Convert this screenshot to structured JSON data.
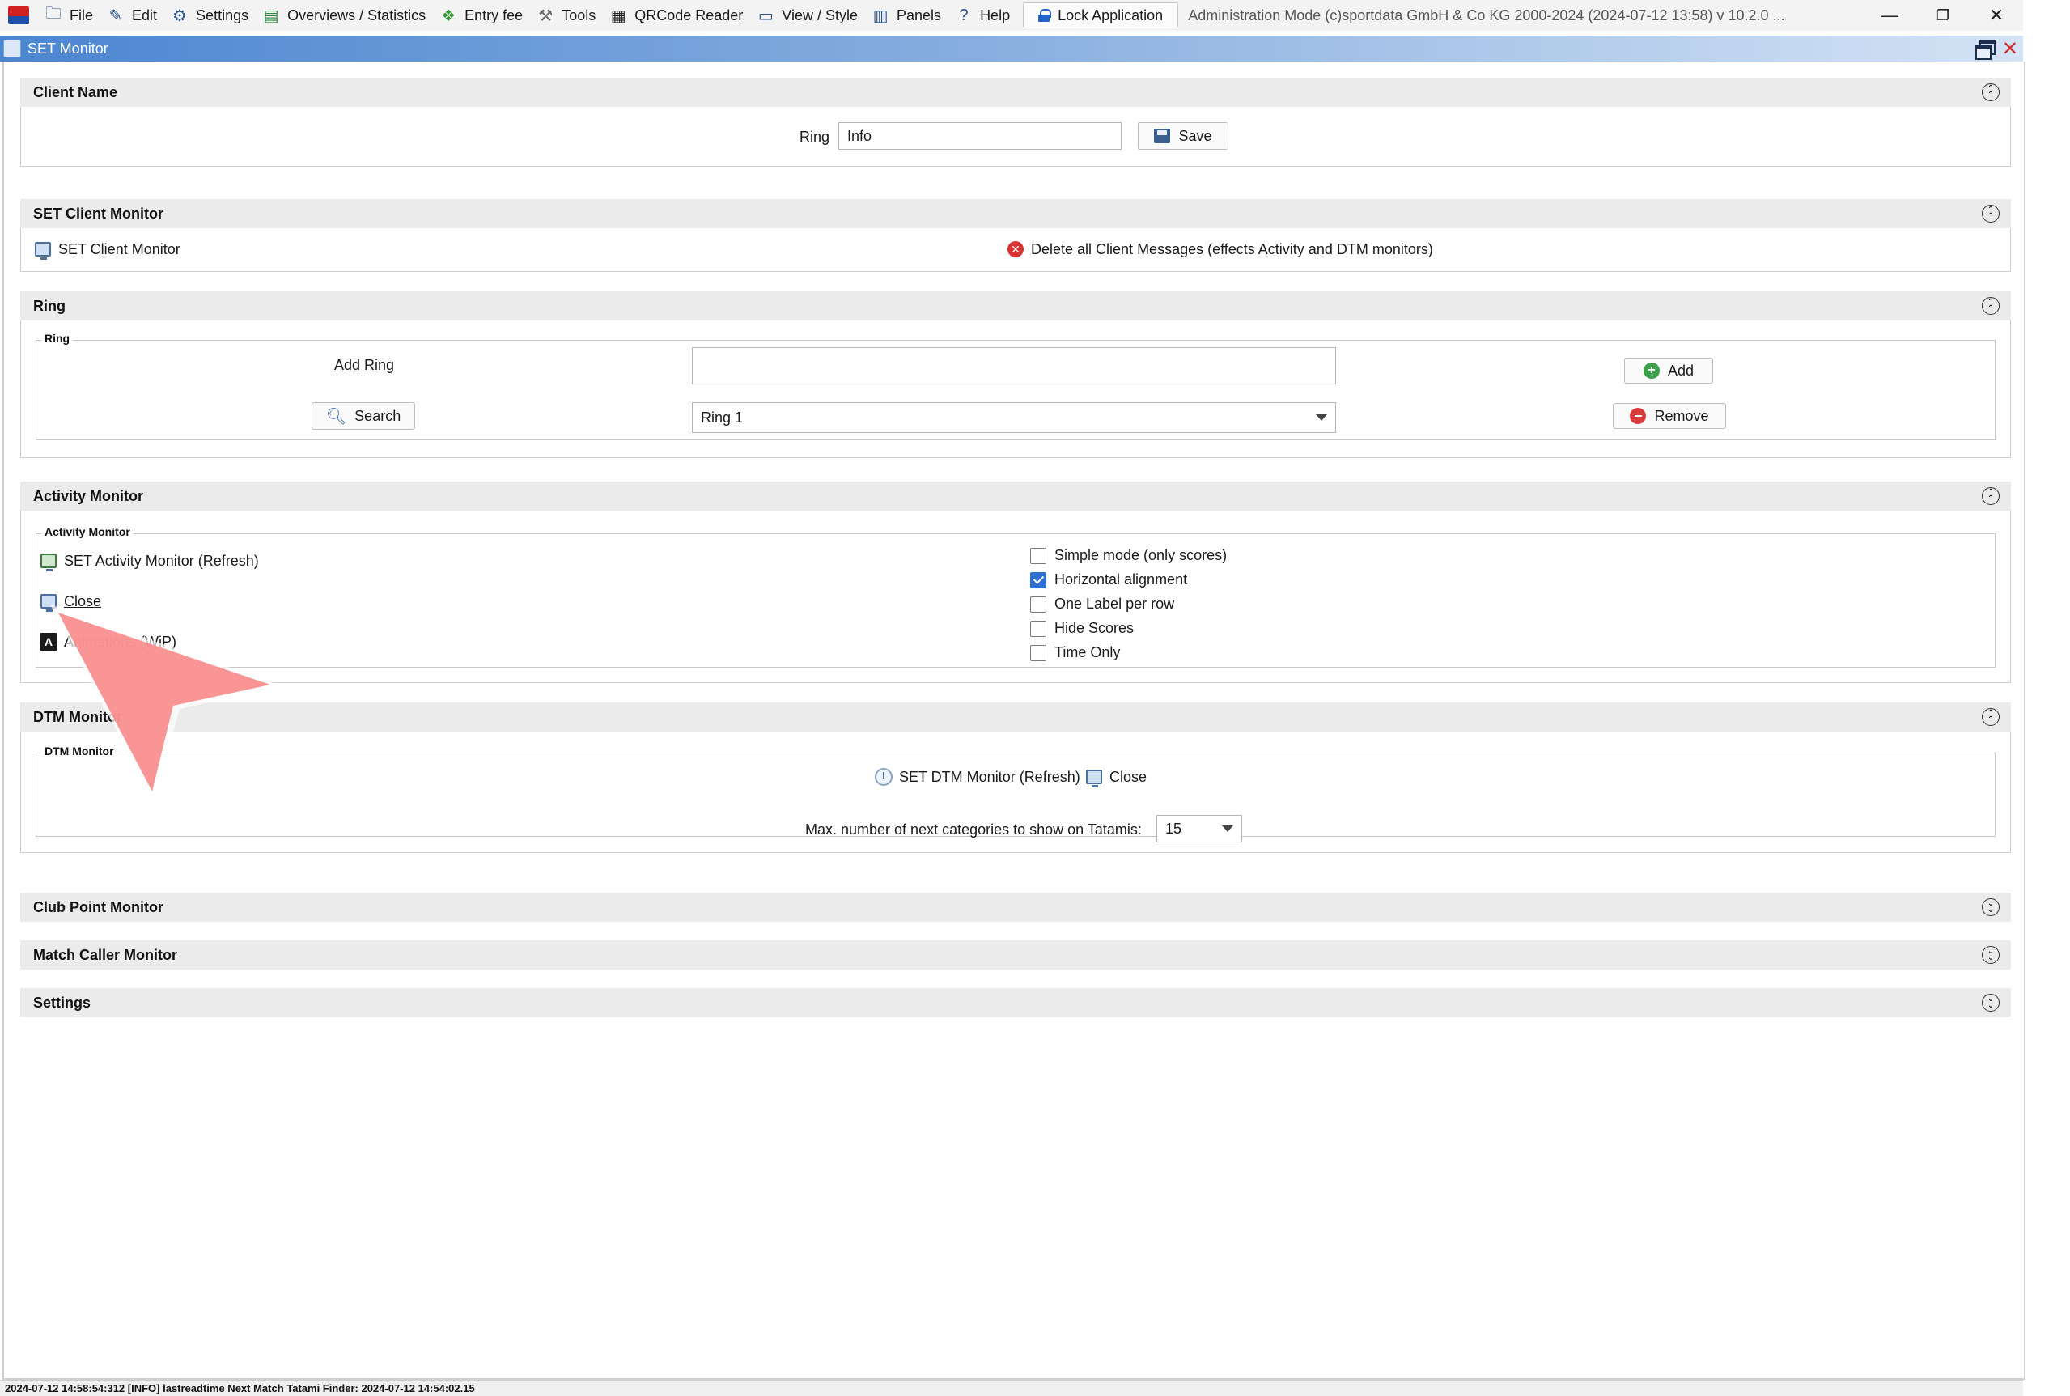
{
  "menubar": {
    "items": [
      {
        "label": "File",
        "icon": "file-icon"
      },
      {
        "label": "Edit",
        "icon": "edit-icon"
      },
      {
        "label": "Settings",
        "icon": "gear-icon"
      },
      {
        "label": "Overviews / Statistics",
        "icon": "statistics-icon"
      },
      {
        "label": "Entry fee",
        "icon": "money-icon"
      },
      {
        "label": "Tools",
        "icon": "wrench-icon"
      },
      {
        "label": "QRCode Reader",
        "icon": "qrcode-icon"
      },
      {
        "label": "View / Style",
        "icon": "view-icon"
      },
      {
        "label": "Panels",
        "icon": "panels-icon"
      },
      {
        "label": "Help",
        "icon": "help-icon"
      }
    ],
    "lock_label": "Lock Application",
    "admin_text": "Administration Mode (c)sportdata GmbH & Co KG 2000-2024 (2024-07-12 13:58)  v 10.2.0 ..."
  },
  "window": {
    "title": "SET Monitor"
  },
  "sections": {
    "client_name": {
      "title": "Client Name",
      "ring_label": "Ring",
      "ring_value": "Info",
      "save_label": "Save"
    },
    "set_client_monitor": {
      "title": "SET Client Monitor",
      "monitor_link": "SET Client Monitor",
      "delete_link": "Delete all Client Messages (effects Activity and DTM monitors)"
    },
    "ring": {
      "title": "Ring",
      "group_title": "Ring",
      "add_ring_label": "Add Ring",
      "add_ring_value": "",
      "add_label": "Add",
      "search_label": "Search",
      "selected_ring": "Ring 1",
      "remove_label": "Remove"
    },
    "activity_monitor": {
      "title": "Activity Monitor",
      "group_title": "Activity Monitor",
      "refresh_link": "SET Activity Monitor (Refresh)",
      "close_link": "Close",
      "animations_link": "Animations (WiP)",
      "options": [
        {
          "label": "Simple mode (only scores)",
          "checked": false
        },
        {
          "label": "Horizontal alignment",
          "checked": true
        },
        {
          "label": "One Label per row",
          "checked": false
        },
        {
          "label": "Hide Scores",
          "checked": false
        },
        {
          "label": "Time Only",
          "checked": false
        }
      ]
    },
    "dtm_monitor": {
      "title": "DTM Monitor",
      "group_title": "DTM Monitor",
      "refresh_link": "SET DTM Monitor (Refresh)",
      "close_link": "Close",
      "max_label": "Max. number of next categories to show on Tatamis:",
      "max_value": "15"
    },
    "club_point_monitor": {
      "title": "Club Point Monitor"
    },
    "match_caller_monitor": {
      "title": "Match Caller Monitor"
    },
    "settings": {
      "title": "Settings"
    }
  },
  "status": {
    "text": "2024-07-12 14:58:54:312 [INFO] lastreadtime Next Match Tatami Finder: 2024-07-12 14:54:02.15"
  },
  "colors": {
    "section_header": "#ebebeb",
    "titlebar_start": "#4b86d1",
    "checkbox_checked": "#2f6fcf",
    "pointer": "#f98a8a"
  }
}
